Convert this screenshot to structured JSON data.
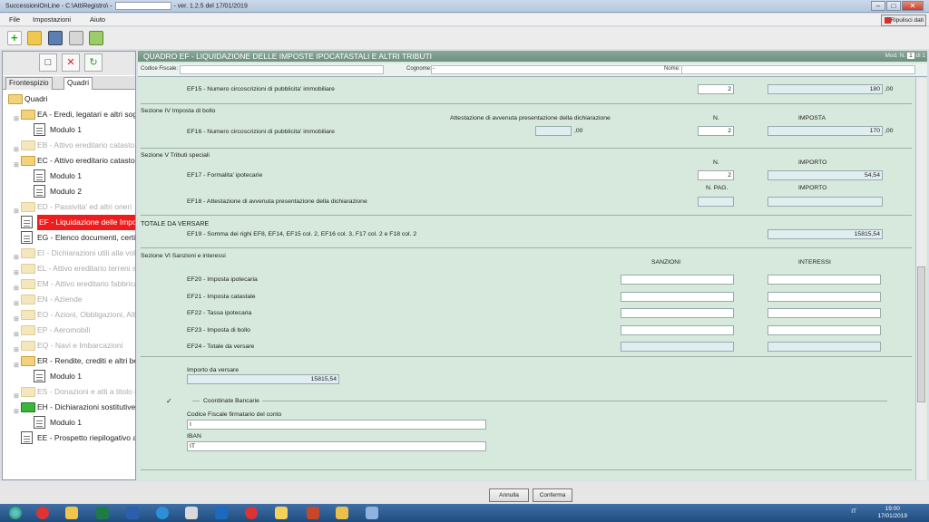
{
  "window": {
    "title": "SuccessioniOnLine - C:\\AttiRegistro\\ -",
    "version": "- ver. 1.2.5 del 17/01/2019"
  },
  "menu": {
    "file": "File",
    "impostazioni": "Impostazioni",
    "aiuto": "Aiuto",
    "ripulisci": "Ripulisci dati"
  },
  "left": {
    "tab_frontespizio": "Frontespizio",
    "tab_quadri": "Quadri",
    "tree": [
      {
        "label": "Quadri",
        "type": "folder",
        "indent": 0,
        "style": "normal"
      },
      {
        "label": "EA - Eredi, legatari e altri sog",
        "type": "folder",
        "indent": 1,
        "style": "normal"
      },
      {
        "label": "Modulo 1",
        "type": "doc",
        "indent": 2,
        "style": "normal"
      },
      {
        "label": "EB - Attivo ereditario catasto",
        "type": "folder",
        "indent": 1,
        "style": "dim"
      },
      {
        "label": "EC - Attivo ereditario catasto",
        "type": "folder",
        "indent": 1,
        "style": "normal"
      },
      {
        "label": "Modulo 1",
        "type": "doc",
        "indent": 2,
        "style": "normal"
      },
      {
        "label": "Modulo 2",
        "type": "doc",
        "indent": 2,
        "style": "normal"
      },
      {
        "label": "ED - Passivita' ed altri oneri",
        "type": "folder",
        "indent": 1,
        "style": "dim"
      },
      {
        "label": "EF - Liquidazione delle Impos",
        "type": "doc",
        "indent": 1,
        "style": "sel"
      },
      {
        "label": "EG - Elenco documenti, certif",
        "type": "doc",
        "indent": 1,
        "style": "normal"
      },
      {
        "label": "EI - Dichiarazioni utili alla vol",
        "type": "folder",
        "indent": 1,
        "style": "dim"
      },
      {
        "label": "EL - Attivo ereditario terreni s",
        "type": "folder",
        "indent": 1,
        "style": "dim"
      },
      {
        "label": "EM - Attivo ereditario fabbrica",
        "type": "folder",
        "indent": 1,
        "style": "dim"
      },
      {
        "label": "EN - Aziende",
        "type": "folder",
        "indent": 1,
        "style": "dim"
      },
      {
        "label": "EO - Azioni, Obbligazioni, Alt",
        "type": "folder",
        "indent": 1,
        "style": "dim"
      },
      {
        "label": "EP - Aeromobili",
        "type": "folder",
        "indent": 1,
        "style": "dim"
      },
      {
        "label": "EQ - Navi e Imbarcazioni",
        "type": "folder",
        "indent": 1,
        "style": "dim"
      },
      {
        "label": "ER - Rendite, crediti e altri be",
        "type": "folder",
        "indent": 1,
        "style": "normal"
      },
      {
        "label": "Modulo 1",
        "type": "doc",
        "indent": 2,
        "style": "normal"
      },
      {
        "label": "ES - Donazioni e atti a titolo g",
        "type": "folder",
        "indent": 1,
        "style": "dim"
      },
      {
        "label": "EH - Dichiarazioni sostitutive,",
        "type": "green",
        "indent": 1,
        "style": "normal"
      },
      {
        "label": "Modulo 1",
        "type": "doc",
        "indent": 2,
        "style": "normal"
      },
      {
        "label": "EE - Prospetto riepilogativo as",
        "type": "doc",
        "indent": 1,
        "style": "normal"
      }
    ]
  },
  "quadro": {
    "title": "QUADRO EF - LIQUIDAZIONE DELLE IMPOSTE IPOCATASTALI E ALTRI TRIBUTI",
    "mod": "Mod. N.",
    "mod_value": "1",
    "mod_of": "di 1"
  },
  "id": {
    "cf_label": "Codice Fiscale:",
    "cognome_label": "Cognome:",
    "cognome_value": "-",
    "nome_label": "Nome:"
  },
  "ef15": {
    "label": "EF15 - Numero circoscrizioni di pubblicita' immobiliare",
    "n": "2",
    "imposta": "180",
    "dec": ",00"
  },
  "sec4": {
    "title": "Sezione IV Imposta di bollo",
    "att_label": "Attestazione di avvenuta presentazione della dichiarazione",
    "n_label": "N.",
    "imposta_label": "IMPOSTA"
  },
  "ef16": {
    "label": "EF16 - Numero circoscrizioni di pubblicita' immobiliare",
    "att": "",
    "att_dec": ",00",
    "n": "2",
    "imposta": "170",
    "dec": ",00"
  },
  "sec5": {
    "title": "Sezione V Tributi speciali",
    "n_label": "N.",
    "importo_label": "IMPORTO"
  },
  "ef17": {
    "label": "EF17 - Formalita' ipotecarie",
    "n": "2",
    "importo": "54,54"
  },
  "ef18": {
    "npag_label": "N. PAG.",
    "importo_label": "IMPORTO",
    "label": "EF18 - Attestazione di avvenuta presentazione della dichiarazione",
    "npag": "",
    "importo": ""
  },
  "totale": {
    "title": "TOTALE DA VERSARE",
    "label": "EF19 - Somma dei righi EF8, EF14, EF15 col. 2, EF16 col. 3, F17 col. 2 e F18 col. 2",
    "value": "15815,54"
  },
  "sec6": {
    "title": "Sezione VI Sanzioni e interessi",
    "sanzioni_label": "SANZIONI",
    "interessi_label": "INTERESSI",
    "rows": [
      {
        "label": "EF20 - Imposta ipotecaria",
        "sanzioni": "",
        "interessi": ""
      },
      {
        "label": "EF21 - Imposta catastale",
        "sanzioni": "",
        "interessi": ""
      },
      {
        "label": "EF22 - Tassa ipotecaria",
        "sanzioni": "",
        "interessi": ""
      },
      {
        "label": "EF23 - Imposta di bollo",
        "sanzioni": "",
        "interessi": ""
      },
      {
        "label": "EF24 - Totale da versare",
        "sanzioni": "",
        "interessi": ""
      }
    ]
  },
  "versare": {
    "label": "Importo da versare",
    "value": "15815,54"
  },
  "bank": {
    "title": "Coordinate Bancarie",
    "cf_label": "Codice Fiscale firmatario del conto",
    "cf_value": "I",
    "iban_label": "IBAN",
    "iban_value": "IT"
  },
  "buttons": {
    "annulla": "Annulla",
    "conferma": "Conferma"
  },
  "taskbar": {
    "lang": "IT",
    "time": "19:00",
    "date": "17/01/2019"
  }
}
